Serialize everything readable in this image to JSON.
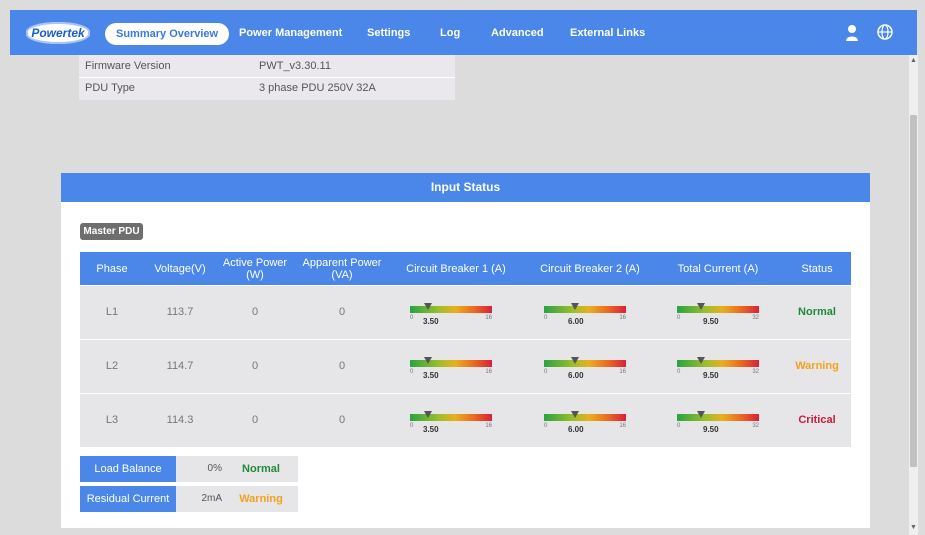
{
  "nav": {
    "logo": "Powertek",
    "items": [
      "Summary Overview",
      "Power Management",
      "Settings",
      "Log",
      "Advanced",
      "External Links"
    ],
    "active": "Summary Overview",
    "icons": [
      "user-icon",
      "globe-icon"
    ]
  },
  "info": {
    "rows": [
      {
        "label": "Firmware Version",
        "value": "PWT_v3.30.11"
      },
      {
        "label": "PDU Type",
        "value": "3 phase PDU 250V 32A"
      }
    ]
  },
  "input_status": {
    "title": "Input Status",
    "badge": "Master PDU",
    "columns": [
      "Phase",
      "Voltage(V)",
      "Active Power (W)",
      "Apparent Power (VA)",
      "Circuit Breaker 1 (A)",
      "Circuit Breaker 2 (A)",
      "Total Current (A)",
      "Status"
    ],
    "rows": [
      {
        "phase": "L1",
        "voltage": "113.7",
        "active": "0",
        "apparent": "0",
        "cb1": {
          "value": "3.50",
          "min": "0",
          "max": "16",
          "level": 0.219
        },
        "cb2": {
          "value": "6.00",
          "min": "0",
          "max": "16",
          "level": 0.375
        },
        "total": {
          "value": "9.50",
          "min": "0",
          "max": "32",
          "level": 0.297
        },
        "status": "Normal"
      },
      {
        "phase": "L2",
        "voltage": "114.7",
        "active": "0",
        "apparent": "0",
        "cb1": {
          "value": "3.50",
          "min": "0",
          "max": "16",
          "level": 0.219
        },
        "cb2": {
          "value": "6.00",
          "min": "0",
          "max": "16",
          "level": 0.375
        },
        "total": {
          "value": "9.50",
          "min": "0",
          "max": "32",
          "level": 0.297
        },
        "status": "Warning"
      },
      {
        "phase": "L3",
        "voltage": "114.3",
        "active": "0",
        "apparent": "0",
        "cb1": {
          "value": "3.50",
          "min": "0",
          "max": "16",
          "level": 0.219
        },
        "cb2": {
          "value": "6.00",
          "min": "0",
          "max": "16",
          "level": 0.375
        },
        "total": {
          "value": "9.50",
          "min": "0",
          "max": "32",
          "level": 0.297
        },
        "status": "Critical"
      }
    ]
  },
  "summary": {
    "load_balance": {
      "label": "Load Balance",
      "value": "0%",
      "status": "Normal"
    },
    "residual_current": {
      "label": "Residual Current",
      "value": "2mA",
      "status": "Warning"
    }
  },
  "colors": {
    "accent": "#4a87e9",
    "normal": "#1f8a3b",
    "warning": "#f4a21b",
    "critical": "#c81e38"
  }
}
